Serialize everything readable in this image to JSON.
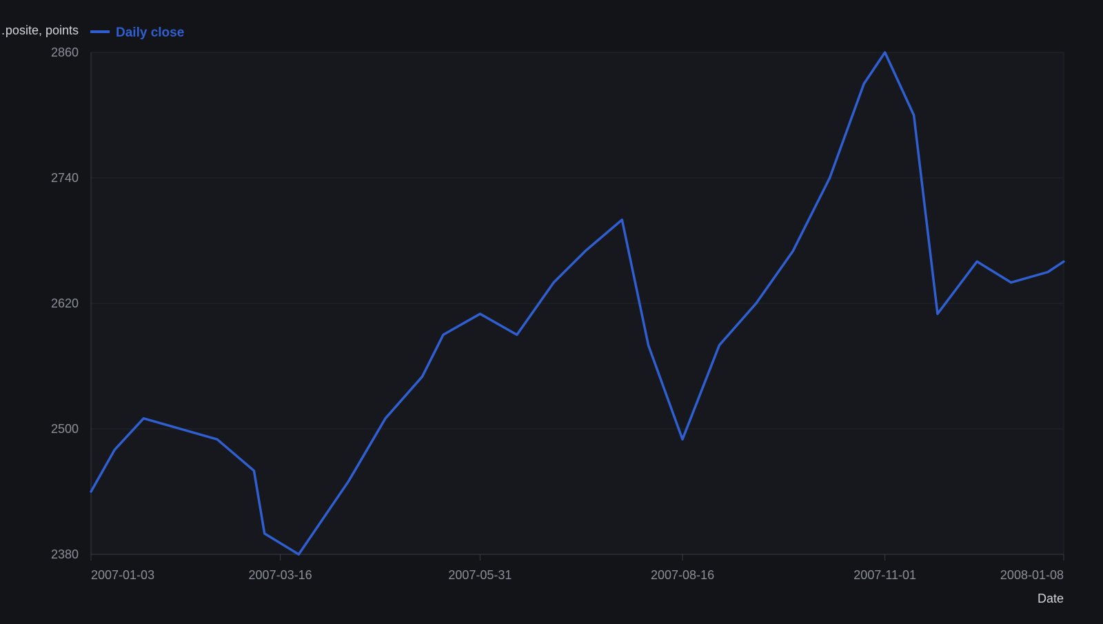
{
  "chart_data": {
    "type": "line",
    "title": "",
    "ylabel": "…posite, points",
    "xlabel": "Date",
    "ylim": [
      2380,
      2860
    ],
    "yticks": [
      2380,
      2500,
      2620,
      2740,
      2860
    ],
    "xlim": [
      "2007-01-03",
      "2008-01-08"
    ],
    "xticks": [
      "2007-01-03",
      "2007-03-16",
      "2007-05-31",
      "2007-08-16",
      "2007-11-01",
      "2008-01-08"
    ],
    "grid": true,
    "legend": "top-left",
    "colors": {
      "background": "#121418",
      "plot_background": "#16181d",
      "grid": "#23262d",
      "axis": "#3a3d45",
      "tick_text": "#8b8f98",
      "label_text": "#d2d5db",
      "series": "#2f5fd0"
    },
    "series": [
      {
        "name": "Daily close",
        "x": [
          "2007-01-03",
          "2007-01-12",
          "2007-01-23",
          "2007-02-06",
          "2007-02-20",
          "2007-03-06",
          "2007-03-10",
          "2007-03-23",
          "2007-04-11",
          "2007-04-25",
          "2007-05-09",
          "2007-05-17",
          "2007-05-31",
          "2007-06-14",
          "2007-06-28",
          "2007-07-10",
          "2007-07-24",
          "2007-08-03",
          "2007-08-16",
          "2007-08-30",
          "2007-09-13",
          "2007-09-27",
          "2007-10-11",
          "2007-10-24",
          "2007-11-01",
          "2007-11-12",
          "2007-11-21",
          "2007-12-06",
          "2007-12-19",
          "2008-01-02",
          "2008-01-08"
        ],
        "y": [
          2440,
          2480,
          2510,
          2500,
          2490,
          2460,
          2400,
          2380,
          2450,
          2510,
          2550,
          2590,
          2610,
          2590,
          2640,
          2670,
          2700,
          2580,
          2490,
          2580,
          2620,
          2670,
          2740,
          2830,
          2860,
          2800,
          2610,
          2660,
          2640,
          2650,
          2660
        ]
      }
    ]
  }
}
